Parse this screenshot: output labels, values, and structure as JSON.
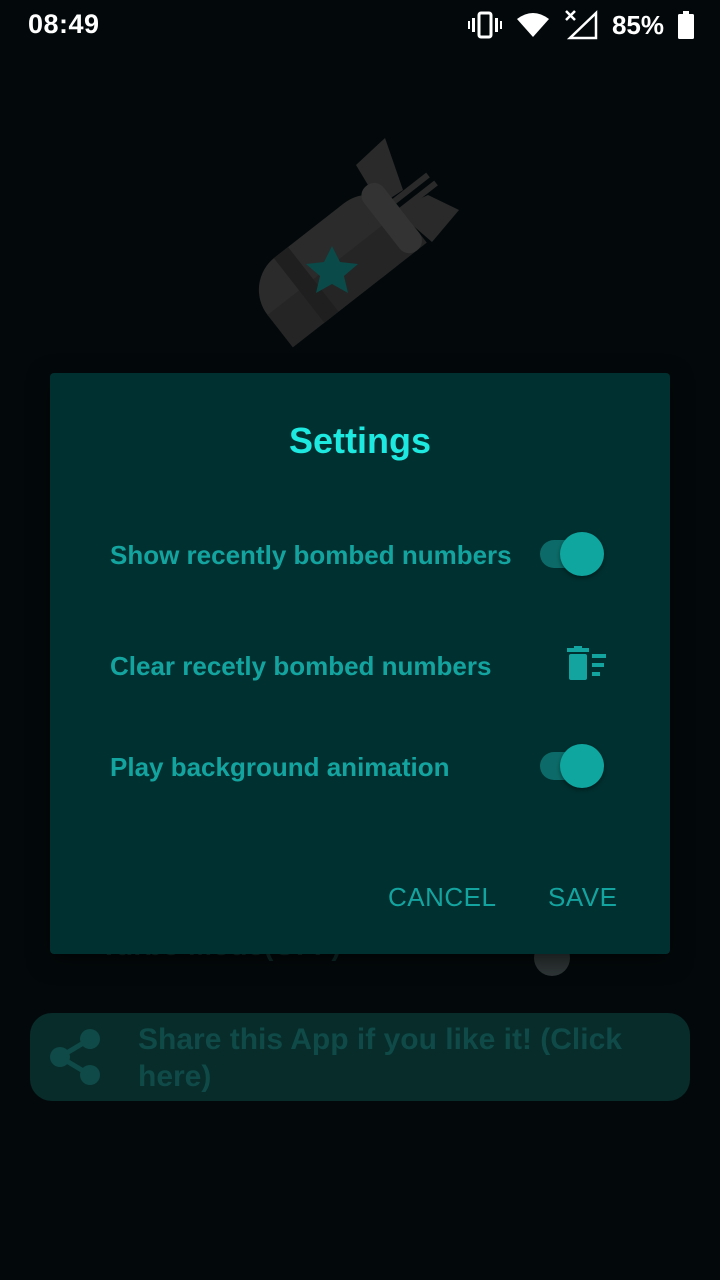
{
  "status_bar": {
    "time": "08:49",
    "battery": "85%",
    "icons": [
      "vibrate-icon",
      "wifi-icon",
      "cellular-no-data-icon",
      "battery-icon"
    ]
  },
  "background": {
    "logo_icon": "bomb-icon",
    "turbo_mode_label": "Turbo Mode(OFF)",
    "share_text": "Share this App if you like it! (Click here)",
    "share_icon": "share-icon"
  },
  "dialog": {
    "title": "Settings",
    "settings": [
      {
        "label": "Show recently bombed numbers",
        "control": "toggle",
        "on": true
      },
      {
        "label": "Clear recetly bombed numbers",
        "control": "delete-sweep-icon"
      },
      {
        "label": "Play background animation",
        "control": "toggle",
        "on": true
      }
    ],
    "cancel_label": "CANCEL",
    "save_label": "SAVE"
  },
  "colors": {
    "background": "#03090b",
    "dialog": "#003030",
    "accent_title": "#1de9e0",
    "accent": "#14a4a0",
    "toggle_knob": "#0fa6a0"
  }
}
